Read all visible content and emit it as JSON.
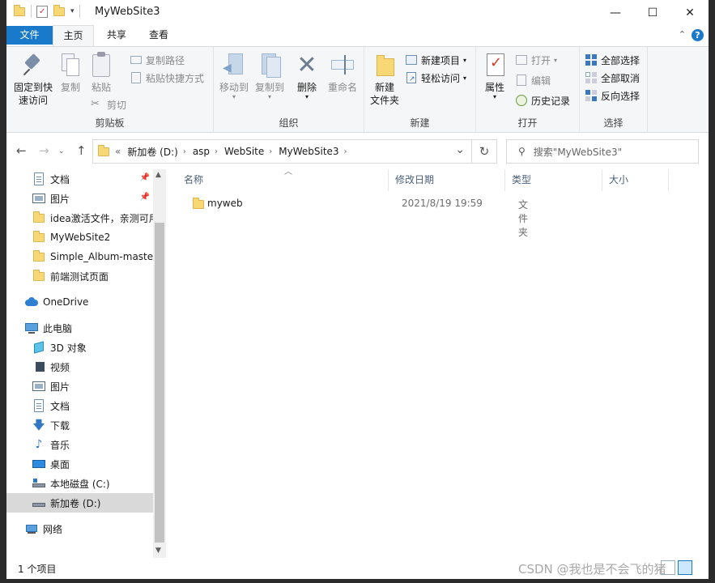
{
  "window": {
    "title": "MyWebSite3",
    "controls": {
      "minimize": "—",
      "maximize": "☐",
      "close": "✕"
    }
  },
  "tabs": {
    "file": "文件",
    "home": "主页",
    "share": "共享",
    "view": "查看"
  },
  "ribbon": {
    "clipboard": {
      "label": "剪贴板",
      "pin_quick_access_line1": "固定到快",
      "pin_quick_access_line2": "速访问",
      "copy": "复制",
      "paste": "粘贴",
      "copy_path": "复制路径",
      "paste_shortcut": "粘贴快捷方式",
      "cut": "剪切"
    },
    "organize": {
      "label": "组织",
      "move_to": "移动到",
      "copy_to": "复制到",
      "delete": "删除",
      "rename": "重命名"
    },
    "new": {
      "label": "新建",
      "new_folder_line1": "新建",
      "new_folder_line2": "文件夹",
      "new_item": "新建项目",
      "easy_access": "轻松访问"
    },
    "open": {
      "label": "打开",
      "properties": "属性",
      "open": "打开",
      "edit": "编辑",
      "history": "历史记录"
    },
    "select": {
      "label": "选择",
      "select_all": "全部选择",
      "select_none": "全部取消",
      "invert_selection": "反向选择"
    }
  },
  "address": {
    "back": "←",
    "forward": "→",
    "up": "↑",
    "overflow": "«",
    "crumbs": [
      "新加卷 (D:)",
      "asp",
      "WebSite",
      "MyWebSite3"
    ],
    "dropdown": "⌄",
    "refresh": "↻",
    "search_placeholder": "搜索\"MyWebSite3\""
  },
  "nav": {
    "quick_access": [
      {
        "label": "文档",
        "icon": "document-icon",
        "pinned": true
      },
      {
        "label": "图片",
        "icon": "picture-icon",
        "pinned": true
      },
      {
        "label": "idea激活文件，亲测可用",
        "icon": "folder-icon",
        "pinned": false
      },
      {
        "label": "MyWebSite2",
        "icon": "folder-icon",
        "pinned": false
      },
      {
        "label": "Simple_Album-master",
        "icon": "folder-icon",
        "pinned": false
      },
      {
        "label": "前端测试页面",
        "icon": "folder-icon",
        "pinned": false
      }
    ],
    "onedrive": "OneDrive",
    "this_pc": "此电脑",
    "pc_items": [
      {
        "label": "3D 对象",
        "icon": "3d-objects-icon"
      },
      {
        "label": "视频",
        "icon": "video-icon"
      },
      {
        "label": "图片",
        "icon": "picture-icon"
      },
      {
        "label": "文档",
        "icon": "document-icon"
      },
      {
        "label": "下载",
        "icon": "download-icon"
      },
      {
        "label": "音乐",
        "icon": "music-icon"
      },
      {
        "label": "桌面",
        "icon": "desktop-icon"
      },
      {
        "label": "本地磁盘 (C:)",
        "icon": "drive-c-icon"
      },
      {
        "label": "新加卷 (D:)",
        "icon": "drive-d-icon",
        "selected": true
      }
    ],
    "network": "网络"
  },
  "columns": {
    "name": "名称",
    "modified": "修改日期",
    "type": "类型",
    "size": "大小"
  },
  "files": [
    {
      "name": "myweb",
      "modified": "2021/8/19 19:59",
      "type": "文件夹",
      "size": ""
    }
  ],
  "status": {
    "count": "1 个项目"
  },
  "watermark": "CSDN @我也是不会飞的猪",
  "colors": {
    "accent": "#1979ca",
    "folder": "#f8d775",
    "selected": "#d9d9d9"
  }
}
